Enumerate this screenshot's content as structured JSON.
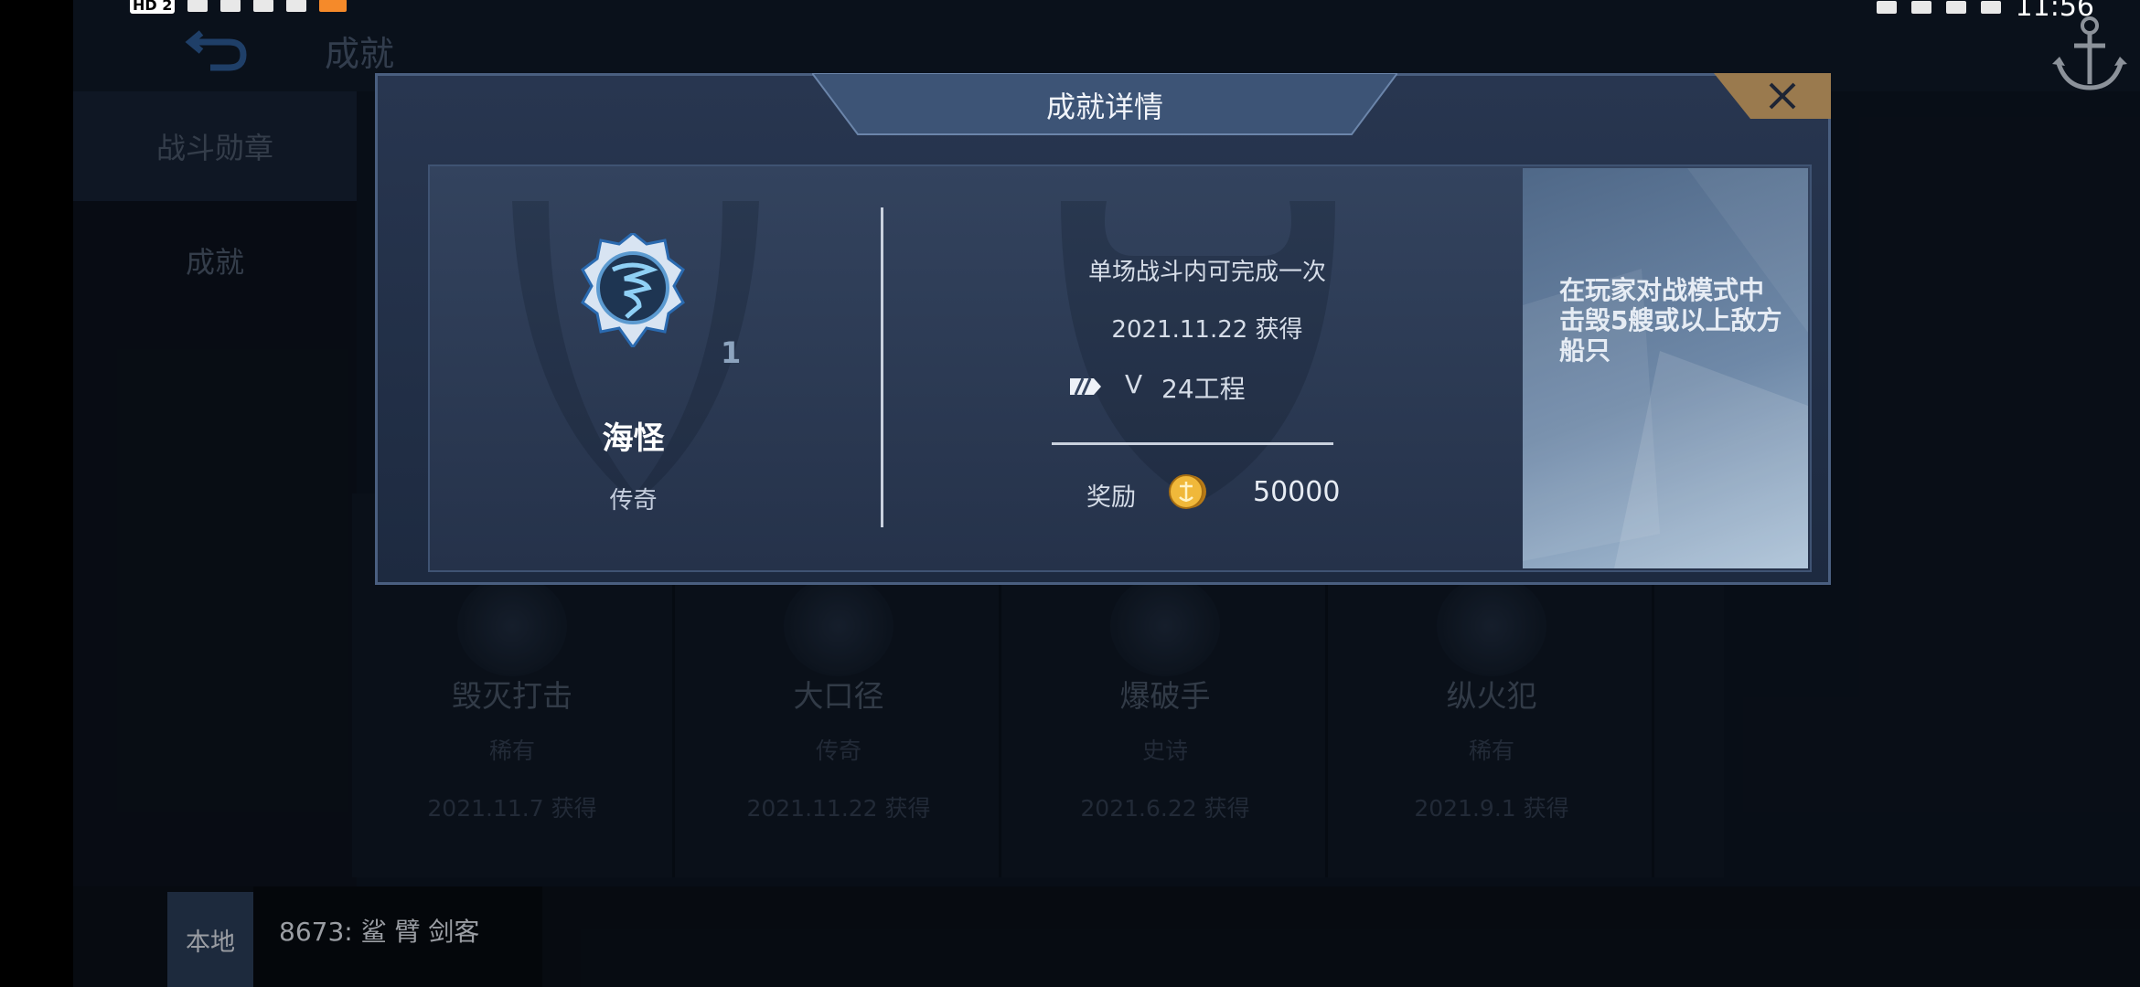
{
  "status_bar": {
    "hd_badge": "HD 2",
    "clock": "11:56"
  },
  "page": {
    "title": "成就",
    "sidebar": [
      {
        "label": "战斗勋章",
        "active": true
      },
      {
        "label": "成就",
        "active": false
      }
    ]
  },
  "cards": [
    {
      "name": "毁灭打击",
      "rarity": "稀有",
      "date": "2021.11.7  获得"
    },
    {
      "name": "大口径",
      "rarity": "传奇",
      "date": "2021.11.22  获得"
    },
    {
      "name": "爆破手",
      "rarity": "史诗",
      "date": "2021.6.22  获得"
    },
    {
      "name": "纵火犯",
      "rarity": "稀有",
      "date": "2021.9.1  获得"
    }
  ],
  "chat": {
    "tab": "本地",
    "message": "8673: 鲨 臂 剑客"
  },
  "dialog": {
    "title": "成就详情",
    "close_label": "✕",
    "achievement": {
      "name": "海怪",
      "rarity": "传奇",
      "level": "1",
      "condition": "单场战斗内可完成一次",
      "date": "2021.11.22  获得",
      "player_rank": "V",
      "player_name": "24工程",
      "reward_label": "奖励",
      "reward_value": "50000",
      "description": "在玩家对战模式中击毁5艘或以上敌方船只"
    }
  }
}
